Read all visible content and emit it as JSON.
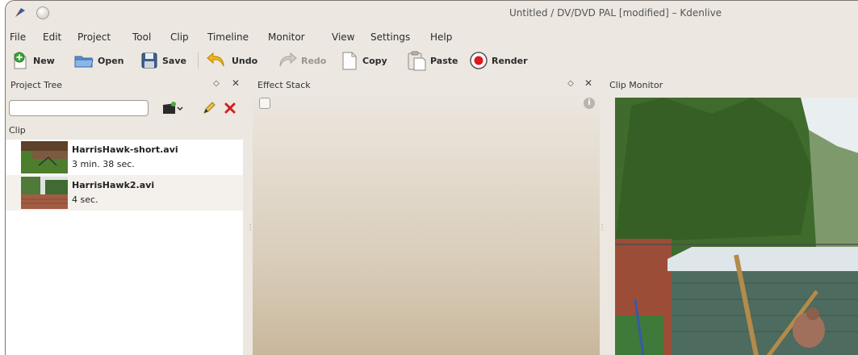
{
  "window": {
    "title": "Untitled / DV/DVD PAL [modified] – Kdenlive"
  },
  "menu": [
    {
      "label": "File"
    },
    {
      "label": "Edit"
    },
    {
      "label": "Project"
    },
    {
      "label": "Tool"
    },
    {
      "label": "Clip"
    },
    {
      "label": "Timeline"
    },
    {
      "label": "Monitor"
    },
    {
      "label": "View"
    },
    {
      "label": "Settings"
    },
    {
      "label": "Help"
    }
  ],
  "toolbar": {
    "new_label": "New",
    "open_label": "Open",
    "save_label": "Save",
    "undo_label": "Undo",
    "redo_label": "Redo",
    "copy_label": "Copy",
    "paste_label": "Paste",
    "render_label": "Render"
  },
  "project_tree": {
    "title": "Project Tree",
    "search_value": "",
    "column_header": "Clip",
    "clips": [
      {
        "name": "HarrisHawk-short.avi",
        "duration": "3 min. 38 sec."
      },
      {
        "name": "HarrisHawk2.avi",
        "duration": "4 sec."
      }
    ]
  },
  "effect_stack": {
    "title": "Effect Stack"
  },
  "clip_monitor": {
    "title": "Clip Monitor"
  },
  "colors": {
    "window_bg": "#ece7e0",
    "render_red": "#e0171b",
    "delete_red": "#d42020"
  }
}
